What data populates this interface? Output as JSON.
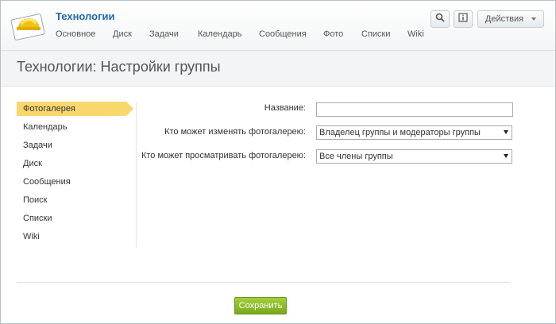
{
  "header": {
    "group_title": "Технологии",
    "nav": [
      "Основное",
      "Диск",
      "Задачи",
      "Календарь",
      "Сообщения",
      "Фото",
      "Списки",
      "Wiki"
    ],
    "search_icon": "search-icon",
    "info_icon": "info-icon",
    "actions_label": "Действия"
  },
  "page": {
    "title": "Технологии: Настройки группы"
  },
  "sidebar": {
    "items": [
      "Фотогалерея",
      "Календарь",
      "Задачи",
      "Диск",
      "Сообщения",
      "Поиск",
      "Списки",
      "Wiki"
    ],
    "active_index": 0
  },
  "form": {
    "name_label": "Название:",
    "name_value": "",
    "edit_label": "Кто может изменять фотогалерею:",
    "edit_value": "Владелец группы и модераторы группы",
    "view_label": "Кто может просматривать фотогалерею:",
    "view_value": "Все члены группы"
  },
  "footer": {
    "save_label": "Сохранить"
  },
  "colors": {
    "accent": "#2067b0",
    "active_item": "#f8d76d",
    "save_button": "#8dbc2a"
  }
}
